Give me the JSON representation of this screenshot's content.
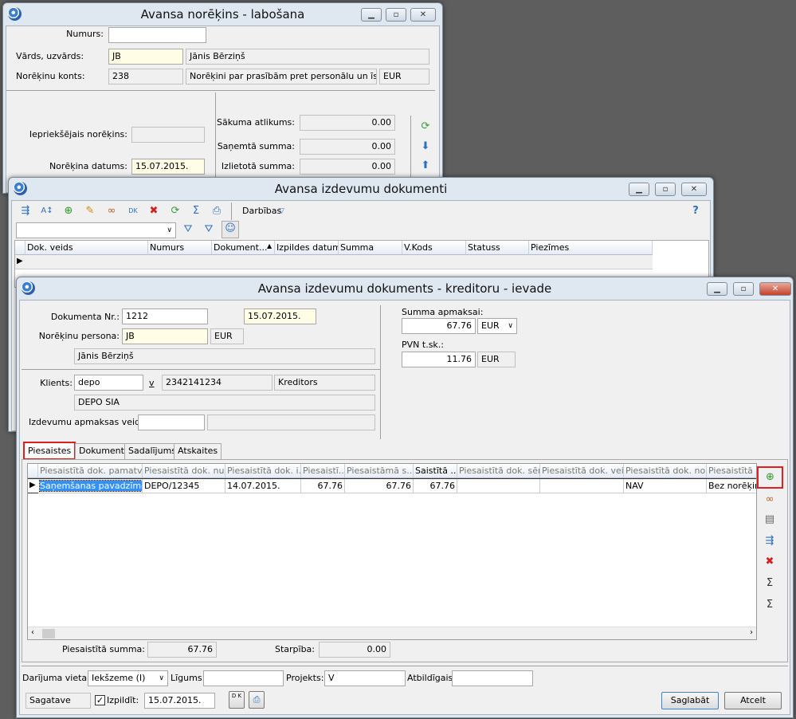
{
  "win1": {
    "title": "Avansa norēķins - labošana",
    "numurs_label": "Numurs:",
    "numurs": "",
    "vards_label": "Vārds, uzvārds:",
    "vards_code": "JB",
    "vards_name": "Jānis Bērziņš",
    "konts_label": "Norēķinu konts:",
    "konts": "238",
    "konts_desc": "Norēķini par prasībām pret personālu un īstermiņa",
    "konts_cur": "EUR",
    "iepr_label": "Iepriekšējais norēķins:",
    "iepr": "",
    "datums_label": "Norēķina datums:",
    "datums": "15.07.2015.",
    "sakuma_label": "Sākuma atlikums:",
    "sakuma": "0.00",
    "sanemta_label": "Saņemtā summa:",
    "sanemta": "0.00",
    "izlietota_label": "Izlietotā summa:",
    "izlietota": "0.00"
  },
  "win2": {
    "title": "Avansa izdevumu dokumenti",
    "actions": "Darbības",
    "columns": [
      "Dok. veids",
      "Numurs",
      "Dokument...",
      "Izpildes datums",
      "Summa",
      "V.Kods",
      "Statuss",
      "Piezīmes"
    ]
  },
  "win3": {
    "title": "Avansa izdevumu dokuments - kreditoru - ievade",
    "doknr_label": "Dokumenta Nr.:",
    "doknr": "1212",
    "date": "15.07.2015.",
    "persona_label": "Norēķinu persona:",
    "persona": "JB",
    "persona_cur": "EUR",
    "persona_name": "Jānis Bērziņš",
    "klients_label": "Klients:",
    "klients": "depo",
    "v": "v",
    "klients_code": "2342141234",
    "klients_type": "Kreditors",
    "klients_name": "DEPO SIA",
    "apm_label": "Izdevumu apmaksas veids:",
    "apm": "",
    "apm_desc": "",
    "summa_label": "Summa apmaksai:",
    "summa": "67.76",
    "summa_cur": "EUR",
    "pvn_label": "PVN t.sk.:",
    "pvn": "11.76",
    "pvn_cur": "EUR",
    "tabs": [
      "Piesaistes",
      "Dokuments",
      "Sadalījums",
      "Atskaites"
    ],
    "columns": [
      "Piesaistītā dok. pamatv...",
      "Piesaistītā dok. nu...",
      "Piesaistītā dok. i...",
      "Piesaistī...",
      "Piesaistāmā s...",
      "Saistītā ...",
      "Piesaistītā dok. sērija",
      "Piesaistītā dok. vei...",
      "Piesaistītā dok. no...",
      "Piesaistītā d"
    ],
    "row": [
      "Saņemšanas pavadzīme",
      "DEPO/12345",
      "14.07.2015.",
      "67.76",
      "67.76",
      "67.76",
      "",
      "",
      "NAV",
      "Bez norēķinu"
    ],
    "piesaist_label": "Piesaistītā summa:",
    "piesaist": "67.76",
    "starpiba_label": "Starpība:",
    "starpiba": "0.00",
    "darijuma_label": "Darījuma vieta:",
    "darijuma": "Iekšzeme (I)",
    "ligums_label": "Līgums:",
    "ligums": "",
    "projekts_label": "Projekts:",
    "projekts": "V",
    "atbildigais_label": "Atbildīgais:",
    "atbildigais": "",
    "status": "Sagatave",
    "izpildit_label": "Izpildīt:",
    "izpildit_date": "15.07.2015.",
    "dk": "D K",
    "save": "Saglabāt",
    "cancel": "Atcelt"
  }
}
